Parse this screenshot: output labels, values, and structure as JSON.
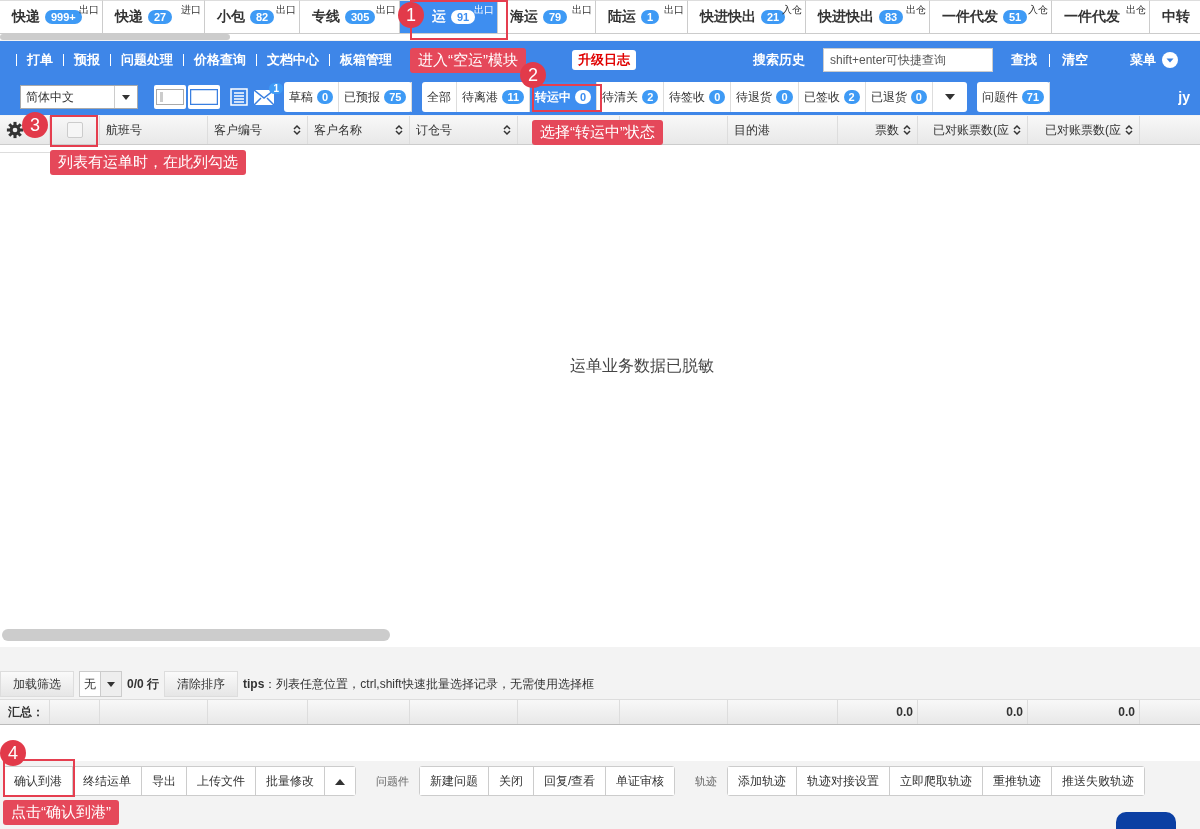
{
  "module_tabs": [
    {
      "label": "快递",
      "count": "999+",
      "tag": "出口",
      "selected": false
    },
    {
      "label": "快递",
      "count": "27",
      "tag": "进口",
      "selected": false
    },
    {
      "label": "小包",
      "count": "82",
      "tag": "出口",
      "selected": false
    },
    {
      "label": "专线",
      "count": "305",
      "tag": "出口",
      "selected": false
    },
    {
      "label": "运",
      "count": "91",
      "tag": "出口",
      "selected": true
    },
    {
      "label": "海运",
      "count": "79",
      "tag": "出口",
      "selected": false
    },
    {
      "label": "陆运",
      "count": "1",
      "tag": "出口",
      "selected": false
    },
    {
      "label": "快进快出",
      "count": "21",
      "tag": "入仓",
      "selected": false
    },
    {
      "label": "快进快出",
      "count": "83",
      "tag": "出仓",
      "selected": false
    },
    {
      "label": "一件代发",
      "count": "51",
      "tag": "入仓",
      "selected": false
    },
    {
      "label": "一件代发",
      "tag": "出仓",
      "selected": false
    },
    {
      "label": "中转",
      "selected": false
    }
  ],
  "nav": {
    "items": [
      "打单",
      "预报",
      "问题处理",
      "价格查询",
      "文档中心",
      "板箱管理"
    ],
    "upgrade_log": "升级日志",
    "search_history": "搜索历史",
    "search": {
      "placeholder": "shift+enter可快捷查询"
    },
    "find": "查找",
    "clear": "清空",
    "menu": "菜单"
  },
  "toolbar": {
    "language": "简体中文",
    "mail_badge": "1",
    "user": "jy",
    "status_groups": [
      [
        {
          "label": "草稿",
          "count": "0",
          "selected": false
        },
        {
          "label": "已预报",
          "count": "75",
          "selected": false
        }
      ],
      [
        {
          "label": "全部",
          "selected": false
        },
        {
          "label": "待离港",
          "count": "11",
          "selected": false
        },
        {
          "label": "转运中",
          "count": "0",
          "selected": true
        },
        {
          "label": "待清关",
          "count": "2",
          "selected": false
        },
        {
          "label": "待签收",
          "count": "0",
          "selected": false
        },
        {
          "label": "待退货",
          "count": "0",
          "selected": false
        },
        {
          "label": "已签收",
          "count": "2",
          "selected": false
        },
        {
          "label": "已退货",
          "count": "0",
          "selected": false
        }
      ],
      [
        {
          "label": "问题件",
          "count": "71",
          "selected": false
        }
      ]
    ]
  },
  "table": {
    "checked_all": false,
    "columns": [
      {
        "name": "航班号"
      },
      {
        "name": "客户编号",
        "sortable": true
      },
      {
        "name": "客户名称",
        "sortable": true
      },
      {
        "name": "订仓号",
        "sortable": true
      },
      {},
      {},
      {
        "name": "目的港"
      },
      {
        "name": "票数",
        "sortable": true,
        "total": "0.0"
      },
      {
        "name": "已对账票数(应",
        "sortable": true,
        "total": "0.0"
      },
      {
        "name": "已对账票数(应",
        "sortable": true,
        "total": "0.0"
      }
    ],
    "empty_message": "运单业务数据已脱敏"
  },
  "filter_bar": {
    "load_filter": "加载筛选",
    "filter_value": "无",
    "rows": "0/0 行",
    "clear_sort": "清除排序",
    "tips": "**tips**：列表任意位置，ctrl,shift快速批量选择记录，无需使用选择框"
  },
  "summary_label": "汇总：",
  "action_groups": [
    {
      "buttons": [
        "确认到港",
        "终结运单",
        "导出",
        "上传文件",
        "批量修改"
      ],
      "has_more": true
    },
    {
      "label": "问题件",
      "buttons": [
        "新建问题",
        "关闭",
        "回复/查看",
        "单证审核"
      ]
    },
    {
      "label": "轨迹",
      "buttons": [
        "添加轨迹",
        "轨迹对接设置",
        "立即爬取轨迹",
        "重推轨迹",
        "推送失败轨迹"
      ]
    }
  ],
  "annotations": [
    {
      "number": "1",
      "text": "进入“空运”模块"
    },
    {
      "number": "2",
      "text": "选择“转运中”状态"
    },
    {
      "number": "3",
      "text": "列表有运单时，在此列勾选"
    },
    {
      "number": "4",
      "text": "点击“确认到港”"
    }
  ]
}
